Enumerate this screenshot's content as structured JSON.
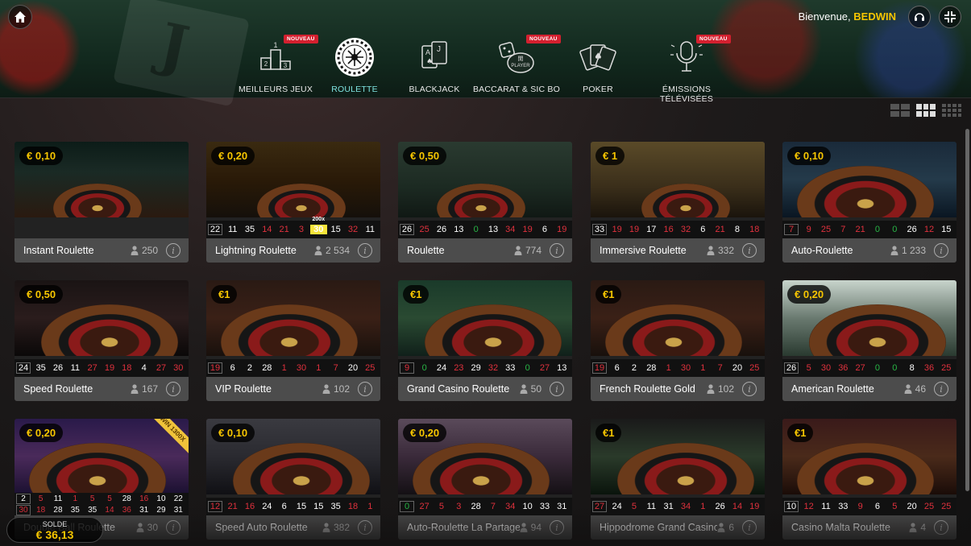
{
  "header": {
    "welcome": "Bienvenue,",
    "username": "BEDWIN",
    "new_badge": "NOUVEAU"
  },
  "nav": [
    {
      "label": "MEILLEURS JEUX",
      "icon": "podium-icon",
      "badge": true
    },
    {
      "label": "ROULETTE",
      "icon": "roulette-wheel-icon",
      "badge": false,
      "active": true
    },
    {
      "label": "BLACKJACK",
      "icon": "blackjack-cards-icon",
      "badge": false
    },
    {
      "label": "BACCARAT & SIC BO",
      "icon": "dice-player-icon",
      "badge": true
    },
    {
      "label": "POKER",
      "icon": "poker-cards-icon",
      "badge": false
    },
    {
      "label": "ÉMISSIONS TÉLÉVISÉES",
      "icon": "microphone-icon",
      "badge": true
    }
  ],
  "tiles": [
    {
      "name": "Instant Roulette",
      "price": "€ 0,10",
      "players": "250",
      "results": []
    },
    {
      "name": "Lightning Roulette",
      "price": "€ 0,20",
      "players": "2 534",
      "results": [
        [
          "22",
          ""
        ],
        [
          "11",
          ""
        ],
        [
          "35",
          ""
        ],
        [
          "14",
          "r"
        ],
        [
          "21",
          "r"
        ],
        [
          "3",
          "r"
        ],
        [
          "30",
          "hl"
        ],
        [
          "15",
          ""
        ],
        [
          "32",
          "r"
        ],
        [
          "11",
          ""
        ]
      ],
      "multiplier": "200x"
    },
    {
      "name": "Roulette",
      "price": "€ 0,50",
      "players": "774",
      "results": [
        [
          "26",
          ""
        ],
        [
          "25",
          "r"
        ],
        [
          "26",
          ""
        ],
        [
          "13",
          ""
        ],
        [
          "0",
          "g"
        ],
        [
          "13",
          ""
        ],
        [
          "34",
          "r"
        ],
        [
          "19",
          "r"
        ],
        [
          "6",
          ""
        ],
        [
          "19",
          "r"
        ]
      ]
    },
    {
      "name": "Immersive Roulette",
      "price": "€ 1",
      "players": "332",
      "results": [
        [
          "33",
          ""
        ],
        [
          "19",
          "r"
        ],
        [
          "19",
          "r"
        ],
        [
          "17",
          ""
        ],
        [
          "16",
          "r"
        ],
        [
          "32",
          "r"
        ],
        [
          "6",
          ""
        ],
        [
          "21",
          "r"
        ],
        [
          "8",
          ""
        ],
        [
          "18",
          "r"
        ]
      ]
    },
    {
      "name": "Auto-Roulette",
      "price": "€ 0,10",
      "players": "1 233",
      "results": [
        [
          "7",
          "r"
        ],
        [
          "9",
          "r"
        ],
        [
          "25",
          "r"
        ],
        [
          "7",
          "r"
        ],
        [
          "21",
          "r"
        ],
        [
          "0",
          "g"
        ],
        [
          "0",
          "g"
        ],
        [
          "26",
          ""
        ],
        [
          "12",
          "r"
        ],
        [
          "15",
          ""
        ]
      ]
    },
    {
      "name": "Speed Roulette",
      "price": "€ 0,50",
      "players": "167",
      "results": [
        [
          "24",
          ""
        ],
        [
          "35",
          ""
        ],
        [
          "26",
          ""
        ],
        [
          "11",
          ""
        ],
        [
          "27",
          "r"
        ],
        [
          "19",
          "r"
        ],
        [
          "18",
          "r"
        ],
        [
          "4",
          ""
        ],
        [
          "27",
          "r"
        ],
        [
          "30",
          "r"
        ]
      ]
    },
    {
      "name": "VIP Roulette",
      "price": "€1",
      "players": "102",
      "results": [
        [
          "19",
          "r"
        ],
        [
          "6",
          ""
        ],
        [
          "2",
          ""
        ],
        [
          "28",
          ""
        ],
        [
          "1",
          "r"
        ],
        [
          "30",
          "r"
        ],
        [
          "1",
          "r"
        ],
        [
          "7",
          "r"
        ],
        [
          "20",
          ""
        ],
        [
          "25",
          "r"
        ]
      ]
    },
    {
      "name": "Grand Casino Roulette",
      "price": "€1",
      "players": "50",
      "results": [
        [
          "9",
          "r"
        ],
        [
          "0",
          "g"
        ],
        [
          "24",
          ""
        ],
        [
          "23",
          "r"
        ],
        [
          "29",
          ""
        ],
        [
          "32",
          "r"
        ],
        [
          "33",
          ""
        ],
        [
          "0",
          "g"
        ],
        [
          "27",
          "r"
        ],
        [
          "13",
          ""
        ]
      ]
    },
    {
      "name": "French Roulette Gold",
      "price": "€1",
      "players": "102",
      "results": [
        [
          "19",
          "r"
        ],
        [
          "6",
          ""
        ],
        [
          "2",
          ""
        ],
        [
          "28",
          ""
        ],
        [
          "1",
          "r"
        ],
        [
          "30",
          "r"
        ],
        [
          "1",
          "r"
        ],
        [
          "7",
          "r"
        ],
        [
          "20",
          ""
        ],
        [
          "25",
          "r"
        ]
      ]
    },
    {
      "name": "American Roulette",
      "price": "€ 0,20",
      "players": "46",
      "results": [
        [
          "26",
          ""
        ],
        [
          "5",
          "r"
        ],
        [
          "30",
          "r"
        ],
        [
          "36",
          "r"
        ],
        [
          "27",
          "r"
        ],
        [
          "0",
          "g"
        ],
        [
          "0",
          "g"
        ],
        [
          "8",
          ""
        ],
        [
          "36",
          "r"
        ],
        [
          "25",
          "r"
        ]
      ]
    },
    {
      "name": "Double Ball Roulette",
      "price": "€ 0,20",
      "players": "30",
      "ribbon": "WIN 1300X",
      "results": []
    },
    {
      "name": "Speed Auto Roulette",
      "price": "€ 0,10",
      "players": "382",
      "results": [
        [
          "12",
          "r"
        ],
        [
          "21",
          "r"
        ],
        [
          "16",
          "r"
        ],
        [
          "24",
          ""
        ],
        [
          "6",
          ""
        ],
        [
          "15",
          ""
        ],
        [
          "15",
          ""
        ],
        [
          "35",
          ""
        ],
        [
          "18",
          "r"
        ],
        [
          "1",
          "r"
        ]
      ]
    },
    {
      "name": "Auto-Roulette La Partage",
      "price": "€ 0,20",
      "players": "94",
      "results": [
        [
          "0",
          "g"
        ],
        [
          "27",
          "r"
        ],
        [
          "5",
          "r"
        ],
        [
          "3",
          "r"
        ],
        [
          "28",
          ""
        ],
        [
          "7",
          "r"
        ],
        [
          "34",
          "r"
        ],
        [
          "10",
          ""
        ],
        [
          "33",
          ""
        ],
        [
          "31",
          ""
        ]
      ]
    },
    {
      "name": "Hippodrome Grand Casino",
      "price": "€1",
      "players": "6",
      "results": [
        [
          "27",
          "r"
        ],
        [
          "24",
          ""
        ],
        [
          "5",
          "r"
        ],
        [
          "11",
          ""
        ],
        [
          "31",
          ""
        ],
        [
          "34",
          "r"
        ],
        [
          "1",
          "r"
        ],
        [
          "26",
          ""
        ],
        [
          "14",
          "r"
        ],
        [
          "19",
          "r"
        ]
      ]
    },
    {
      "name": "Casino Malta Roulette",
      "price": "€1",
      "players": "4",
      "results": [
        [
          "10",
          ""
        ],
        [
          "12",
          "r"
        ],
        [
          "11",
          ""
        ],
        [
          "33",
          ""
        ],
        [
          "9",
          "r"
        ],
        [
          "6",
          ""
        ],
        [
          "5",
          "r"
        ],
        [
          "20",
          ""
        ],
        [
          "25",
          "r"
        ],
        [
          "25",
          "r"
        ]
      ]
    }
  ],
  "double_ball_results": {
    "top": [
      [
        "2",
        ""
      ],
      [
        "5",
        "r"
      ],
      [
        "11",
        ""
      ],
      [
        "1",
        "r"
      ],
      [
        "5",
        "r"
      ],
      [
        "5",
        "r"
      ],
      [
        "28",
        ""
      ],
      [
        "16",
        "r"
      ],
      [
        "10",
        ""
      ],
      [
        "22",
        ""
      ]
    ],
    "bottom": [
      [
        "30",
        "r"
      ],
      [
        "18",
        "r"
      ],
      [
        "28",
        ""
      ],
      [
        "35",
        ""
      ],
      [
        "35",
        ""
      ],
      [
        "14",
        "r"
      ],
      [
        "36",
        "r"
      ],
      [
        "31",
        ""
      ],
      [
        "29",
        ""
      ],
      [
        "31",
        ""
      ]
    ]
  },
  "balance": {
    "label": "SOLDE",
    "value": "€ 36,13"
  },
  "colors": {
    "accent_gold": "#f7c600",
    "active_tab": "#7fe3e0",
    "red": "#e0313d",
    "green": "#28b546",
    "badge_red": "#d4202f"
  }
}
